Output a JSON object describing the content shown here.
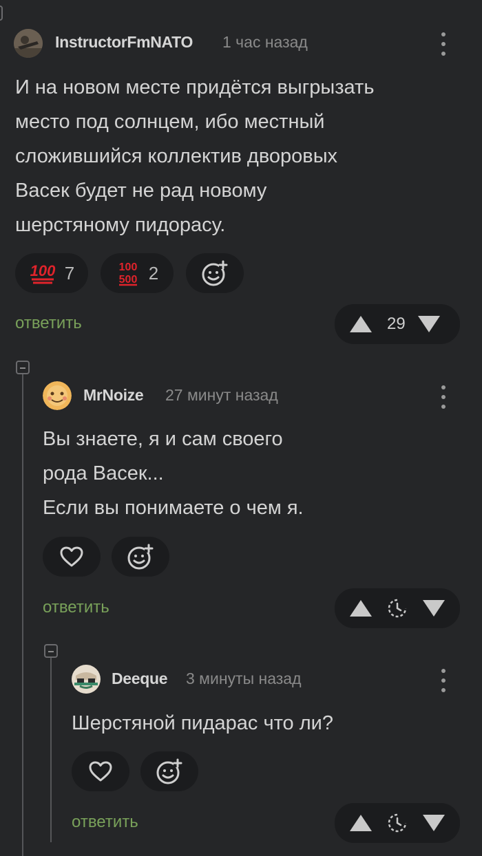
{
  "comments": [
    {
      "author": "InstructorFmNATO",
      "time": "1 час назад",
      "text": "И на новом месте придётся выгрызать\nместо под солнцем, ибо местный\nсложившийся коллектив дворовых\nВасек будет не рад новому\nшерстяному пидорасу.",
      "reactions": [
        {
          "icon": "hundred-emoji",
          "glyph": "💯",
          "count": "7"
        },
        {
          "icon": "hundred-five-hundred-emoji",
          "glyph": "100/500",
          "count": "2"
        }
      ],
      "reply_label": "ответить",
      "rating": "29"
    },
    {
      "author": "MrNoize",
      "time": "27 минут назад",
      "text": "Вы знаете, я и сам своего\nрода Васек...\nЕсли вы понимаете о чем я.",
      "reply_label": "ответить"
    },
    {
      "author": "Deeque",
      "time": "3 минуты назад",
      "text": "Шерстяной пидарас что ли?",
      "reply_label": "ответить"
    }
  ],
  "colors": {
    "background": "#252628",
    "pill": "#1b1c1e",
    "reply": "#79a15a",
    "red_emoji": "#e0232b"
  }
}
